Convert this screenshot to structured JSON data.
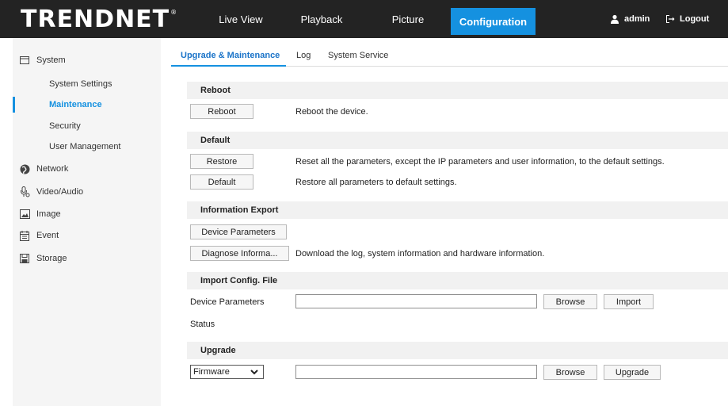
{
  "brand": {
    "logo_text": "TRENDNET",
    "registered": "®"
  },
  "nav": {
    "live_view": "Live View",
    "playback": "Playback",
    "picture": "Picture",
    "configuration": "Configuration"
  },
  "user": {
    "name": "admin",
    "logout": "Logout"
  },
  "sidebar": {
    "system": "System",
    "system_settings": "System Settings",
    "maintenance": "Maintenance",
    "security": "Security",
    "user_management": "User Management",
    "network": "Network",
    "video_audio": "Video/Audio",
    "image": "Image",
    "event": "Event",
    "storage": "Storage"
  },
  "tabs": {
    "upgrade_maintenance": "Upgrade & Maintenance",
    "log": "Log",
    "system_service": "System Service"
  },
  "reboot": {
    "title": "Reboot",
    "button": "Reboot",
    "description": "Reboot the device."
  },
  "default": {
    "title": "Default",
    "restore_button": "Restore",
    "restore_description": "Reset all the parameters, except the IP parameters and user information, to the default settings.",
    "default_button": "Default",
    "default_description": "Restore all parameters to default settings."
  },
  "export": {
    "title": "Information Export",
    "device_params_button": "Device Parameters",
    "diagnose_button": "Diagnose Informa...",
    "diagnose_description": "Download the log, system information and hardware information."
  },
  "import": {
    "title": "Import Config. File",
    "device_params_label": "Device Parameters",
    "browse": "Browse",
    "import": "Import",
    "status_label": "Status"
  },
  "upgrade": {
    "title": "Upgrade",
    "type_selected": "Firmware",
    "browse": "Browse",
    "upgrade": "Upgrade"
  }
}
